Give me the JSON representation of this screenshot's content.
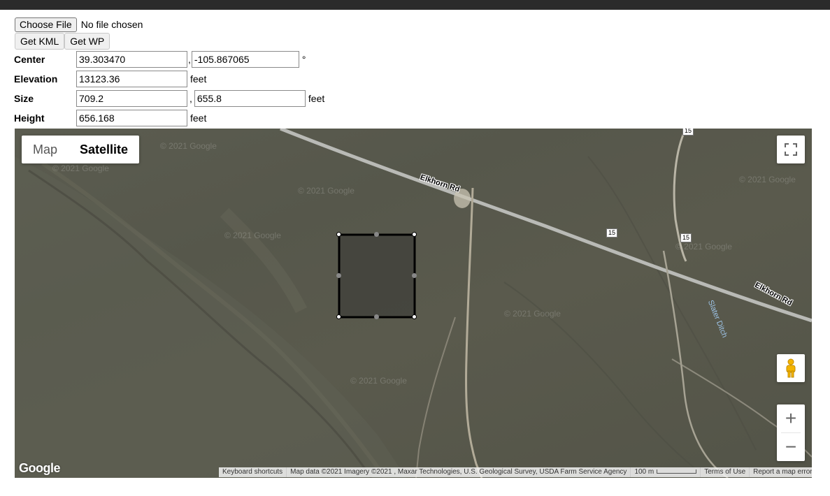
{
  "file": {
    "choose_label": "Choose File",
    "status": "No file chosen"
  },
  "actions": {
    "get_kml_label": "Get KML",
    "get_wp_label": "Get WP"
  },
  "form": {
    "center": {
      "label": "Center",
      "lat": "39.303470",
      "lng": "-105.867065",
      "separator": ",",
      "unit": "°"
    },
    "elevation": {
      "label": "Elevation",
      "value": "13123.36",
      "unit": "feet"
    },
    "size": {
      "label": "Size",
      "width": "709.2",
      "length": "655.8",
      "separator": ",",
      "unit": "feet"
    },
    "height": {
      "label": "Height",
      "value": "656.168",
      "unit": "feet"
    }
  },
  "map": {
    "type_map_label": "Map",
    "type_satellite_label": "Satellite",
    "active_type": "Satellite",
    "road_label_1": "Elkhorn Rd",
    "road_label_2": "Elkhorn Rd",
    "ditch_label": "Slater Ditch",
    "shield_1": "15",
    "shield_2": "15",
    "shield_3": "15",
    "watermark": "© 2021 Google",
    "logo_text": "Google",
    "zoom_in": "+",
    "zoom_out": "−",
    "footer": {
      "shortcuts": "Keyboard shortcuts",
      "map_data": "Map data ©2021 Imagery ©2021 , Maxar Technologies, U.S. Geological Survey, USDA Farm Service Agency",
      "scale": "100 m",
      "terms": "Terms of Use",
      "report": "Report a map error"
    },
    "icons": {
      "fullscreen": "fullscreen-icon",
      "pegman": "pegman-icon"
    },
    "colors": {
      "road": "#b9bab6",
      "terrain": "#58594d",
      "polygon_fill": "#3d3d39",
      "polygon_stroke": "#000000"
    }
  }
}
